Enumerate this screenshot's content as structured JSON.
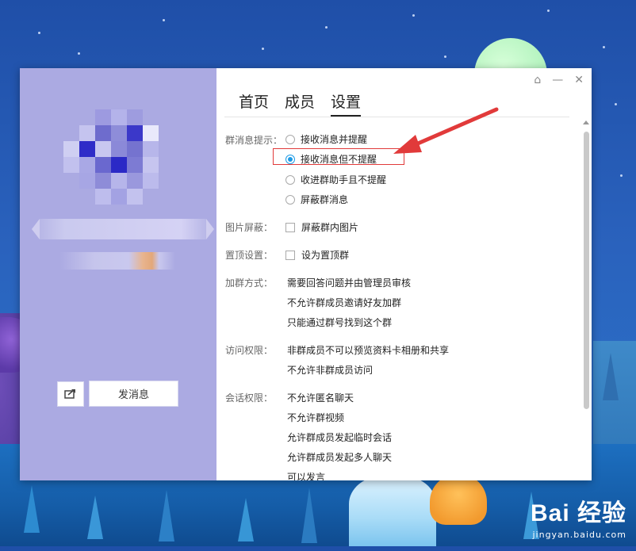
{
  "window": {
    "tabs": [
      {
        "label": "首页"
      },
      {
        "label": "成员"
      },
      {
        "label": "设置"
      }
    ],
    "active_tab": "设置",
    "controls": {
      "skin": "⌂",
      "minimize": "—",
      "close": "✕"
    }
  },
  "left_panel": {
    "send_button": "发消息",
    "share_icon": "share-icon"
  },
  "settings": {
    "group_message": {
      "label": "群消息提示：",
      "options": [
        {
          "label": "接收消息并提醒",
          "selected": false
        },
        {
          "label": "接收消息但不提醒",
          "selected": true
        },
        {
          "label": "收进群助手且不提醒",
          "selected": false
        },
        {
          "label": "屏蔽群消息",
          "selected": false
        }
      ]
    },
    "image_block": {
      "label": "图片屏蔽：",
      "option": "屏蔽群内图片",
      "checked": false
    },
    "pin": {
      "label": "置顶设置：",
      "option": "设为置顶群",
      "checked": false
    },
    "join": {
      "label": "加群方式：",
      "lines": [
        "需要回答问题并由管理员审核",
        "不允许群成员邀请好友加群",
        "只能通过群号找到这个群"
      ]
    },
    "access": {
      "label": "访问权限：",
      "lines": [
        "非群成员不可以预览资料卡相册和共享",
        "不允许非群成员访问"
      ]
    },
    "session": {
      "label": "会话权限：",
      "lines": [
        "不允许匿名聊天",
        "不允许群视频",
        "允许群成员发起临时会话",
        "允许群成员发起多人聊天",
        "可以发言"
      ]
    }
  },
  "colors": {
    "accent": "#1e9be6",
    "annotation": "#e13a3a",
    "left_panel_bg": "#abaae2"
  },
  "watermark": {
    "logo": "Bai 经验",
    "url": "jingyan.baidu.com"
  }
}
